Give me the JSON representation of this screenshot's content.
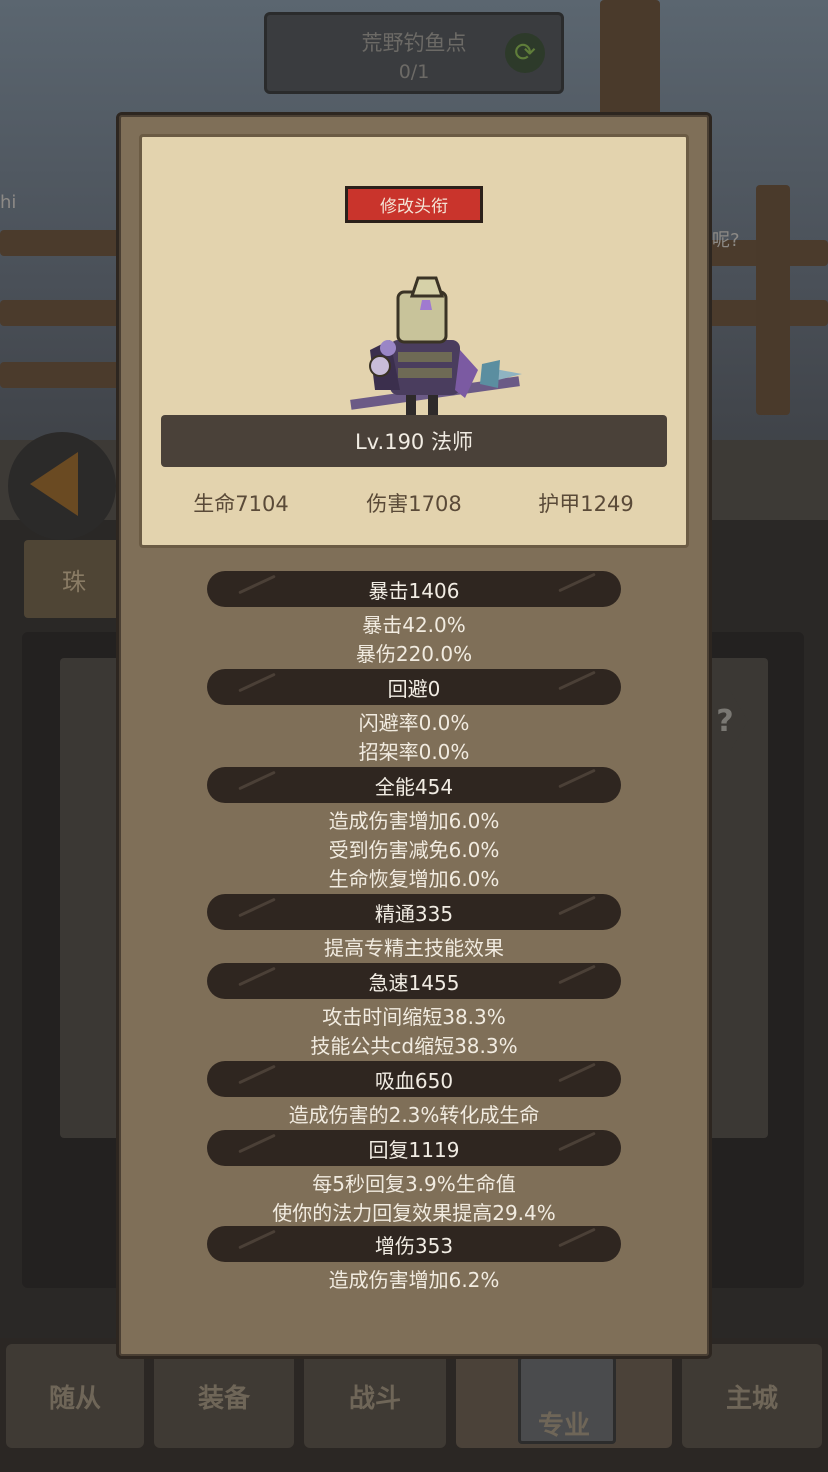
{
  "background": {
    "location_title": "荒野钓鱼点",
    "location_progress": "0/1",
    "side_tab": "珠",
    "edge_left": "hi",
    "edge_right": "呢?",
    "help": "?"
  },
  "nav": {
    "followers": "随从",
    "equipment": "装备",
    "battle": "战斗",
    "profession": "专业",
    "main_city": "主城"
  },
  "card": {
    "edit_title": "修改头衔",
    "level_class": "Lv.190 法师",
    "hp": "生命7104",
    "damage": "伤害1708",
    "armor": "护甲1249"
  },
  "stats": {
    "crit": {
      "label": "暴击1406",
      "lines": [
        "暴击42.0%",
        "暴伤220.0%"
      ]
    },
    "dodge": {
      "label": "回避0",
      "lines": [
        "闪避率0.0%",
        "招架率0.0%"
      ]
    },
    "versatility": {
      "label": "全能454",
      "lines": [
        "造成伤害增加6.0%",
        "受到伤害减免6.0%",
        "生命恢复增加6.0%"
      ]
    },
    "mastery": {
      "label": "精通335",
      "lines": [
        "提高专精主技能效果"
      ]
    },
    "haste": {
      "label": "急速1455",
      "lines": [
        "攻击时间缩短38.3%",
        "技能公共cd缩短38.3%"
      ]
    },
    "leech": {
      "label": "吸血650",
      "lines": [
        "造成伤害的2.3%转化成生命"
      ]
    },
    "regen": {
      "label": "回复1119",
      "lines": [
        "每5秒回复3.9%生命值",
        "使你的法力回复效果提高29.4%"
      ]
    },
    "dmg_bonus": {
      "label": "增伤353",
      "lines": [
        "造成伤害增加6.2%"
      ]
    }
  },
  "colors": {
    "modal": "#7f6f58",
    "card": "#e3d3ae",
    "accent_red": "#c9342c",
    "bar_dark": "#2f2620"
  }
}
